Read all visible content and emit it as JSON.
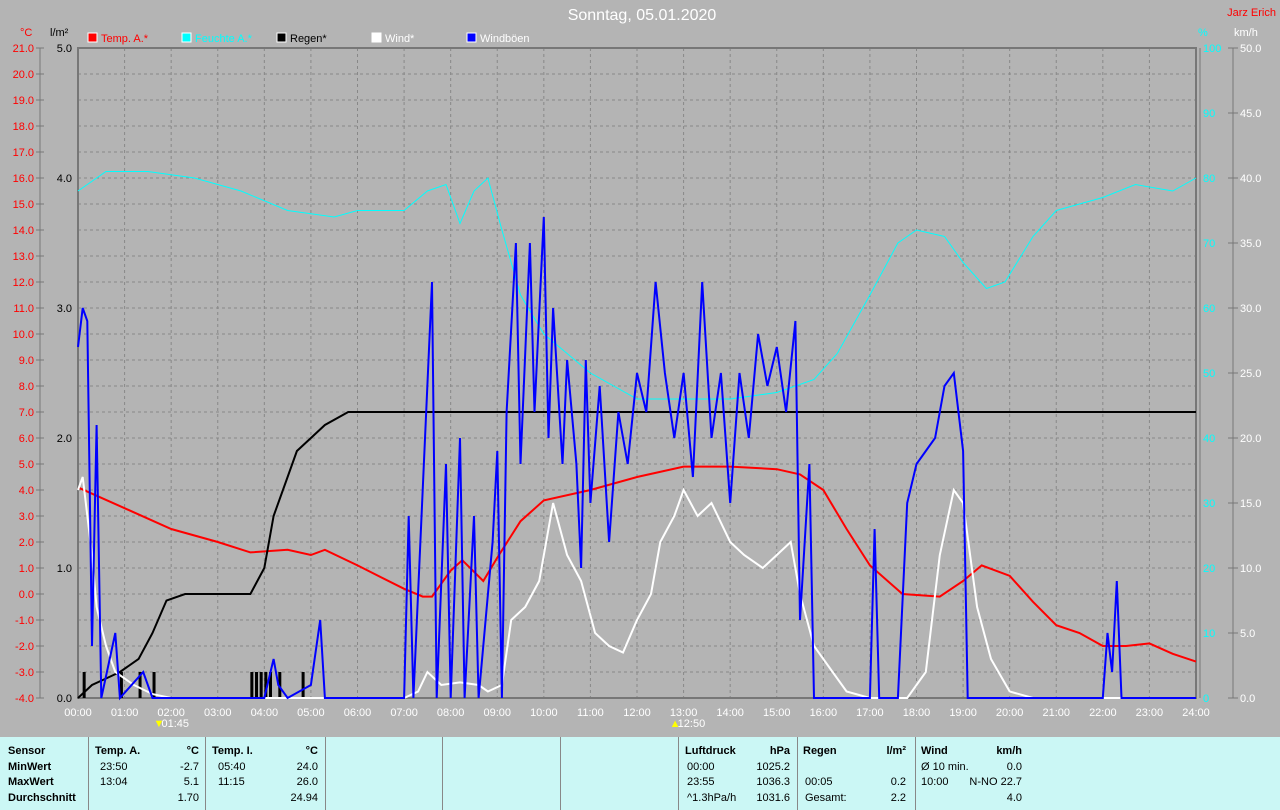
{
  "title": "Sonntag, 05.01.2020",
  "author": "Jarz Erich",
  "chart_data": {
    "type": "line",
    "title": "Sonntag, 05.01.2020",
    "x_range_hours": [
      0,
      24
    ],
    "x_ticks": [
      "00:00",
      "01:00",
      "02:00",
      "03:00",
      "04:00",
      "05:00",
      "06:00",
      "07:00",
      "08:00",
      "09:00",
      "10:00",
      "11:00",
      "12:00",
      "13:00",
      "14:00",
      "15:00",
      "16:00",
      "17:00",
      "18:00",
      "19:00",
      "20:00",
      "21:00",
      "22:00",
      "23:00",
      "24:00"
    ],
    "axes": {
      "temp": {
        "unit": "°C",
        "range": [
          -4,
          21
        ],
        "ticks": [
          "21.0",
          "20.0",
          "19.0",
          "18.0",
          "17.0",
          "16.0",
          "15.0",
          "14.0",
          "13.0",
          "12.0",
          "11.0",
          "10.0",
          "9.0",
          "8.0",
          "7.0",
          "6.0",
          "5.0",
          "4.0",
          "3.0",
          "2.0",
          "1.0",
          "0.0",
          "-1.0",
          "-2.0",
          "-3.0",
          "-4.0"
        ]
      },
      "rain": {
        "unit": "l/m²",
        "range": [
          0,
          5
        ],
        "ticks": [
          "5.0",
          "4.0",
          "3.0",
          "2.0",
          "1.0",
          "0.0"
        ]
      },
      "humidity": {
        "unit": "%",
        "range": [
          0,
          100
        ],
        "ticks": [
          "100",
          "90",
          "80",
          "70",
          "60",
          "50",
          "40",
          "30",
          "20",
          "10",
          "0"
        ]
      },
      "wind": {
        "unit": "km/h",
        "range": [
          0,
          50
        ],
        "ticks": [
          "50.0",
          "45.0",
          "40.0",
          "35.0",
          "30.0",
          "25.0",
          "20.0",
          "15.0",
          "10.0",
          "5.0",
          "0.0"
        ]
      }
    },
    "sun_events": [
      {
        "label": "01:45",
        "hour": 1.75
      },
      {
        "label": "12:50",
        "hour": 12.83
      }
    ],
    "grid": true,
    "legend_position": "top",
    "series": [
      {
        "name": "Temp. A.*",
        "axis": "temp",
        "color": "#ff0000",
        "points": [
          [
            0,
            4.1
          ],
          [
            1,
            3.3
          ],
          [
            2,
            2.5
          ],
          [
            3,
            2.0
          ],
          [
            3.7,
            1.6
          ],
          [
            4.5,
            1.7
          ],
          [
            5,
            1.5
          ],
          [
            5.3,
            1.7
          ],
          [
            6,
            1.1
          ],
          [
            7,
            0.2
          ],
          [
            7.4,
            -0.1
          ],
          [
            7.6,
            -0.1
          ],
          [
            8,
            0.9
          ],
          [
            8.25,
            1.3
          ],
          [
            8.7,
            0.5
          ],
          [
            9,
            1.4
          ],
          [
            9.5,
            2.8
          ],
          [
            10,
            3.6
          ],
          [
            11,
            4.0
          ],
          [
            12,
            4.5
          ],
          [
            13,
            4.9
          ],
          [
            14,
            4.9
          ],
          [
            15,
            4.8
          ],
          [
            15.5,
            4.6
          ],
          [
            16,
            4.0
          ],
          [
            16.5,
            2.5
          ],
          [
            17,
            1.1
          ],
          [
            17.7,
            0.0
          ],
          [
            18.5,
            -0.1
          ],
          [
            19,
            0.5
          ],
          [
            19.4,
            1.1
          ],
          [
            20,
            0.7
          ],
          [
            20.5,
            -0.3
          ],
          [
            21,
            -1.2
          ],
          [
            21.5,
            -1.5
          ],
          [
            22,
            -2.0
          ],
          [
            22.5,
            -2.0
          ],
          [
            23,
            -1.9
          ],
          [
            23.5,
            -2.3
          ],
          [
            24,
            -2.6
          ]
        ]
      },
      {
        "name": "Feuchte A.*",
        "axis": "humidity",
        "color": "#00ffff",
        "points": [
          [
            0,
            78
          ],
          [
            0.6,
            81
          ],
          [
            1.5,
            81
          ],
          [
            2.5,
            80
          ],
          [
            3.5,
            78
          ],
          [
            4.5,
            75
          ],
          [
            5.5,
            74
          ],
          [
            6,
            75
          ],
          [
            7,
            75
          ],
          [
            7.5,
            78
          ],
          [
            7.9,
            79
          ],
          [
            8.2,
            73
          ],
          [
            8.5,
            78
          ],
          [
            8.8,
            80
          ],
          [
            9.1,
            72
          ],
          [
            9.5,
            62
          ],
          [
            10,
            56
          ],
          [
            10.5,
            53
          ],
          [
            11,
            50
          ],
          [
            11.5,
            48
          ],
          [
            12,
            46
          ],
          [
            13,
            46
          ],
          [
            14,
            46
          ],
          [
            15,
            47
          ],
          [
            15.8,
            49
          ],
          [
            16.3,
            53
          ],
          [
            17,
            62
          ],
          [
            17.6,
            70
          ],
          [
            18,
            72
          ],
          [
            18.6,
            71
          ],
          [
            19,
            67
          ],
          [
            19.5,
            63
          ],
          [
            19.9,
            64
          ],
          [
            20.5,
            71
          ],
          [
            21,
            75
          ],
          [
            22,
            77
          ],
          [
            22.7,
            79
          ],
          [
            23.5,
            78
          ],
          [
            24,
            80
          ]
        ]
      },
      {
        "name": "Regen*",
        "axis": "rain",
        "color": "#000000",
        "points": [
          [
            0,
            0
          ],
          [
            0.3,
            0.1
          ],
          [
            0.6,
            0.15
          ],
          [
            0.9,
            0.2
          ],
          [
            1.3,
            0.3
          ],
          [
            1.6,
            0.5
          ],
          [
            1.9,
            0.75
          ],
          [
            2.3,
            0.8
          ],
          [
            3.7,
            0.8
          ],
          [
            4,
            1.0
          ],
          [
            4.2,
            1.4
          ],
          [
            4.5,
            1.7
          ],
          [
            4.7,
            1.9
          ],
          [
            5,
            2.0
          ],
          [
            5.3,
            2.1
          ],
          [
            5.8,
            2.2
          ],
          [
            24,
            2.2
          ]
        ]
      },
      {
        "name": "Wind*",
        "axis": "wind",
        "color": "#ffffff",
        "points": [
          [
            0,
            16
          ],
          [
            0.1,
            17
          ],
          [
            0.3,
            11
          ],
          [
            0.4,
            7
          ],
          [
            0.6,
            4
          ],
          [
            0.8,
            2
          ],
          [
            1.2,
            1
          ],
          [
            1.6,
            0.3
          ],
          [
            2,
            0
          ],
          [
            7,
            0
          ],
          [
            7.3,
            0.5
          ],
          [
            7.5,
            2
          ],
          [
            7.8,
            1
          ],
          [
            8.2,
            1.2
          ],
          [
            8.6,
            1
          ],
          [
            8.8,
            0.5
          ],
          [
            9.1,
            1
          ],
          [
            9.3,
            6
          ],
          [
            9.6,
            7
          ],
          [
            9.9,
            9
          ],
          [
            10.2,
            15
          ],
          [
            10.5,
            11
          ],
          [
            10.8,
            9
          ],
          [
            11.1,
            5
          ],
          [
            11.4,
            4
          ],
          [
            11.7,
            3.5
          ],
          [
            12,
            6
          ],
          [
            12.3,
            8
          ],
          [
            12.5,
            12
          ],
          [
            12.8,
            14
          ],
          [
            13,
            16
          ],
          [
            13.3,
            14
          ],
          [
            13.6,
            15
          ],
          [
            14,
            12
          ],
          [
            14.3,
            11
          ],
          [
            14.7,
            10
          ],
          [
            15,
            11
          ],
          [
            15.3,
            12
          ],
          [
            15.5,
            8
          ],
          [
            15.8,
            4
          ],
          [
            16.2,
            2
          ],
          [
            16.5,
            0.5
          ],
          [
            17,
            0
          ],
          [
            17.8,
            0
          ],
          [
            18.2,
            2
          ],
          [
            18.5,
            11
          ],
          [
            18.8,
            16
          ],
          [
            19,
            15
          ],
          [
            19.3,
            7
          ],
          [
            19.6,
            3
          ],
          [
            20,
            0.5
          ],
          [
            20.5,
            0
          ],
          [
            24,
            0
          ]
        ]
      },
      {
        "name": "Windböen",
        "axis": "wind",
        "color": "#0000ff",
        "points": [
          [
            0,
            27
          ],
          [
            0.1,
            30
          ],
          [
            0.2,
            29
          ],
          [
            0.3,
            4
          ],
          [
            0.4,
            21
          ],
          [
            0.5,
            0
          ],
          [
            0.8,
            5
          ],
          [
            0.9,
            0
          ],
          [
            1.4,
            2
          ],
          [
            1.6,
            0
          ],
          [
            2,
            0
          ],
          [
            4,
            0
          ],
          [
            4.2,
            3
          ],
          [
            4.3,
            1
          ],
          [
            4.5,
            0
          ],
          [
            5,
            1
          ],
          [
            5.2,
            6
          ],
          [
            5.3,
            0
          ],
          [
            7,
            0
          ],
          [
            7.1,
            14
          ],
          [
            7.2,
            0
          ],
          [
            7.4,
            16
          ],
          [
            7.6,
            32
          ],
          [
            7.7,
            0
          ],
          [
            7.9,
            18
          ],
          [
            8,
            0
          ],
          [
            8.2,
            20
          ],
          [
            8.3,
            0
          ],
          [
            8.5,
            14
          ],
          [
            8.6,
            0
          ],
          [
            8.9,
            12
          ],
          [
            9,
            19
          ],
          [
            9.1,
            0
          ],
          [
            9.2,
            22
          ],
          [
            9.4,
            35
          ],
          [
            9.5,
            18
          ],
          [
            9.7,
            35
          ],
          [
            9.8,
            22
          ],
          [
            10,
            37
          ],
          [
            10.1,
            20
          ],
          [
            10.2,
            30
          ],
          [
            10.4,
            18
          ],
          [
            10.5,
            26
          ],
          [
            10.7,
            18
          ],
          [
            10.8,
            10
          ],
          [
            10.9,
            26
          ],
          [
            11,
            15
          ],
          [
            11.2,
            24
          ],
          [
            11.4,
            12
          ],
          [
            11.6,
            22
          ],
          [
            11.8,
            18
          ],
          [
            12,
            25
          ],
          [
            12.2,
            22
          ],
          [
            12.4,
            32
          ],
          [
            12.6,
            25
          ],
          [
            12.8,
            20
          ],
          [
            13,
            25
          ],
          [
            13.2,
            17
          ],
          [
            13.4,
            32
          ],
          [
            13.6,
            20
          ],
          [
            13.8,
            25
          ],
          [
            14,
            15
          ],
          [
            14.2,
            25
          ],
          [
            14.4,
            20
          ],
          [
            14.6,
            28
          ],
          [
            14.8,
            24
          ],
          [
            15,
            27
          ],
          [
            15.2,
            22
          ],
          [
            15.4,
            29
          ],
          [
            15.5,
            6
          ],
          [
            15.7,
            18
          ],
          [
            15.8,
            0
          ],
          [
            16,
            0
          ],
          [
            17,
            0
          ],
          [
            17.1,
            13
          ],
          [
            17.2,
            0
          ],
          [
            17.6,
            0
          ],
          [
            17.8,
            15
          ],
          [
            18,
            18
          ],
          [
            18.2,
            19
          ],
          [
            18.4,
            20
          ],
          [
            18.6,
            24
          ],
          [
            18.8,
            25
          ],
          [
            19,
            19
          ],
          [
            19.1,
            0
          ],
          [
            22,
            0
          ],
          [
            22.1,
            5
          ],
          [
            22.2,
            2
          ],
          [
            22.3,
            9
          ],
          [
            22.4,
            0
          ],
          [
            24,
            0
          ]
        ]
      }
    ]
  },
  "stats": {
    "temp_a": {
      "header": "Sensor",
      "label": "Temp. A.",
      "unit": "°C",
      "rows": [
        [
          "MinWert",
          "23:50",
          "-2.7"
        ],
        [
          "MaxWert",
          "13:04",
          "5.1"
        ],
        [
          "Durchschnitt",
          "",
          "1.70"
        ]
      ]
    },
    "temp_i": {
      "label": "Temp. I.",
      "unit": "°C",
      "rows": [
        [
          "05:40",
          "24.0"
        ],
        [
          "11:15",
          "26.0"
        ],
        [
          "",
          "24.94"
        ]
      ]
    },
    "pressure": {
      "label": "Luftdruck",
      "unit": "hPa",
      "rows": [
        [
          "00:00",
          "1025.2"
        ],
        [
          "23:55",
          "1036.3"
        ],
        [
          "^1.3hPa/h",
          "1031.6"
        ]
      ]
    },
    "rain": {
      "label": "Regen",
      "unit": "l/m²",
      "rows": [
        [
          "",
          ""
        ],
        [
          "00:05",
          "0.2"
        ],
        [
          "Gesamt:",
          "2.2"
        ]
      ]
    },
    "wind": {
      "label": "Wind",
      "unit": "km/h",
      "rows": [
        [
          "Ø 10 min.",
          "0.0"
        ],
        [
          "10:00",
          "N-NO 22.7"
        ],
        [
          "",
          "4.0"
        ]
      ]
    }
  }
}
